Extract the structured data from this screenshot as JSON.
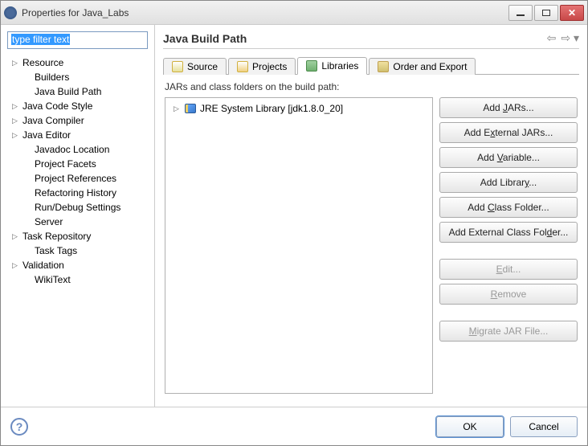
{
  "window": {
    "title": "Properties for Java_Labs"
  },
  "sidebar": {
    "filter_placeholder": "type filter text",
    "items": [
      {
        "label": "Resource",
        "expandable": true
      },
      {
        "label": "Builders",
        "expandable": false
      },
      {
        "label": "Java Build Path",
        "expandable": false
      },
      {
        "label": "Java Code Style",
        "expandable": true
      },
      {
        "label": "Java Compiler",
        "expandable": true
      },
      {
        "label": "Java Editor",
        "expandable": true
      },
      {
        "label": "Javadoc Location",
        "expandable": false
      },
      {
        "label": "Project Facets",
        "expandable": false
      },
      {
        "label": "Project References",
        "expandable": false
      },
      {
        "label": "Refactoring History",
        "expandable": false
      },
      {
        "label": "Run/Debug Settings",
        "expandable": false
      },
      {
        "label": "Server",
        "expandable": false
      },
      {
        "label": "Task Repository",
        "expandable": true
      },
      {
        "label": "Task Tags",
        "expandable": false
      },
      {
        "label": "Validation",
        "expandable": true
      },
      {
        "label": "WikiText",
        "expandable": false
      }
    ]
  },
  "content": {
    "title": "Java Build Path",
    "tabs": {
      "source": "Source",
      "projects": "Projects",
      "libraries": "Libraries",
      "order": "Order and Export",
      "active": "libraries"
    },
    "libraries": {
      "description": "JARs and class folders on the build path:",
      "entries": [
        {
          "label": "JRE System Library [jdk1.8.0_20]"
        }
      ],
      "buttons": {
        "add_jars": "Add JARs...",
        "add_external_jars": "Add External JARs...",
        "add_variable": "Add Variable...",
        "add_library": "Add Library...",
        "add_class_folder": "Add Class Folder...",
        "add_ext_class_folder": "Add External Class Folder...",
        "edit": "Edit...",
        "remove": "Remove",
        "migrate": "Migrate JAR File..."
      }
    }
  },
  "footer": {
    "ok": "OK",
    "cancel": "Cancel"
  }
}
